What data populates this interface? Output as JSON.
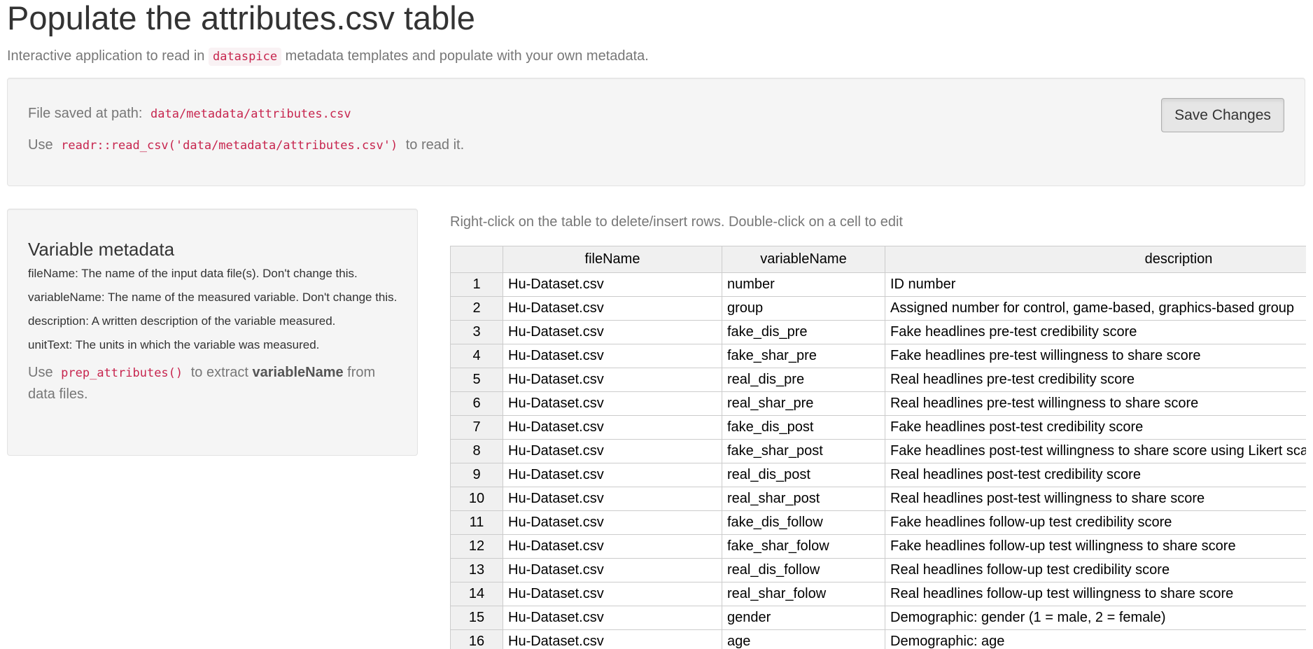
{
  "page": {
    "title": "Populate the attributes.csv table",
    "subtitle_before": "Interactive application to read in",
    "subtitle_code": "dataspice",
    "subtitle_after": "metadata templates and populate with your own metadata."
  },
  "save_panel": {
    "path_label": "File saved at path:",
    "path_value": "data/metadata/attributes.csv",
    "read_before": "Use",
    "read_code": "readr::read_csv('data/metadata/attributes.csv')",
    "read_after": "to read it.",
    "save_button_label": "Save Changes"
  },
  "help_panel": {
    "title": "Variable metadata",
    "items": [
      "fileName: The name of the input data file(s). Don't change this.",
      "variableName: The name of the measured variable. Don't change this.",
      "description: A written description of the variable measured.",
      "unitText: The units in which the variable was measured."
    ],
    "tip_before": "Use",
    "tip_code": "prep_attributes()",
    "tip_middle": "to extract",
    "tip_bold": "variableName",
    "tip_after": "from data files."
  },
  "table": {
    "hint": "Right-click on the table to delete/insert rows. Double-click on a cell to edit",
    "columns": [
      "",
      "fileName",
      "variableName",
      "description"
    ],
    "rows": [
      [
        "1",
        "Hu-Dataset.csv",
        "number",
        "ID number"
      ],
      [
        "2",
        "Hu-Dataset.csv",
        "group",
        "Assigned number for control, game-based, graphics-based group"
      ],
      [
        "3",
        "Hu-Dataset.csv",
        "fake_dis_pre",
        "Fake headlines pre-test credibility score"
      ],
      [
        "4",
        "Hu-Dataset.csv",
        "fake_shar_pre",
        "Fake headlines pre-test willingness to share score"
      ],
      [
        "5",
        "Hu-Dataset.csv",
        "real_dis_pre",
        "Real headlines pre-test credibility score"
      ],
      [
        "6",
        "Hu-Dataset.csv",
        "real_shar_pre",
        "Real headlines pre-test willingness to share score"
      ],
      [
        "7",
        "Hu-Dataset.csv",
        "fake_dis_post",
        "Fake headlines post-test credibility score"
      ],
      [
        "8",
        "Hu-Dataset.csv",
        "fake_shar_post",
        "Fake headlines post-test willingness to share score using Likert scale"
      ],
      [
        "9",
        "Hu-Dataset.csv",
        "real_dis_post",
        "Real headlines post-test credibility score"
      ],
      [
        "10",
        "Hu-Dataset.csv",
        "real_shar_post",
        "Real headlines post-test willingness to share score"
      ],
      [
        "11",
        "Hu-Dataset.csv",
        "fake_dis_follow",
        "Fake headlines follow-up test credibility score"
      ],
      [
        "12",
        "Hu-Dataset.csv",
        "fake_shar_folow",
        "Fake headlines follow-up test willingness to share score"
      ],
      [
        "13",
        "Hu-Dataset.csv",
        "real_dis_follow",
        "Real headlines follow-up test credibility score"
      ],
      [
        "14",
        "Hu-Dataset.csv",
        "real_shar_folow",
        "Real headlines follow-up test willingness to share score"
      ],
      [
        "15",
        "Hu-Dataset.csv",
        "gender",
        "Demographic: gender (1 = male, 2 = female)"
      ],
      [
        "16",
        "Hu-Dataset.csv",
        "age",
        "Demographic: age"
      ]
    ]
  }
}
